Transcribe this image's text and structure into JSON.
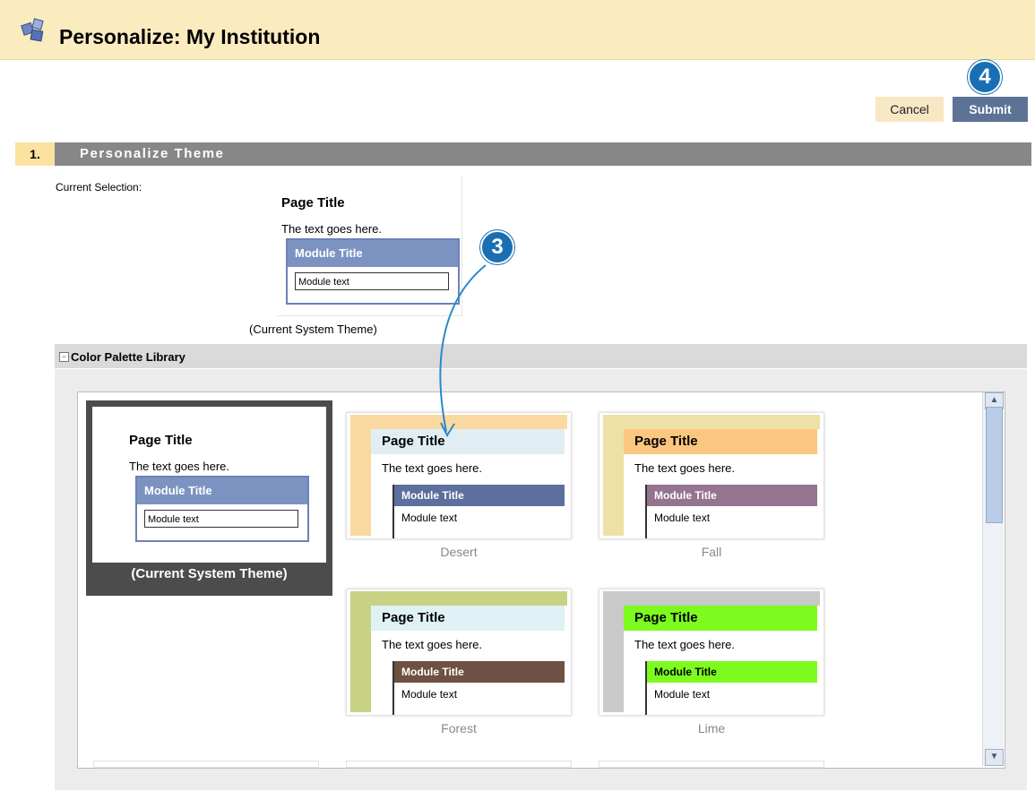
{
  "page": {
    "title": "Personalize: My Institution"
  },
  "buttons": {
    "cancel": "Cancel",
    "submit": "Submit"
  },
  "callouts": {
    "submit_step": "4",
    "select_step": "3"
  },
  "section": {
    "number": "1.",
    "title": "Personalize Theme"
  },
  "current": {
    "label": "Current Selection:",
    "page_title": "Page Title",
    "text": "The text goes here.",
    "module_title": "Module Title",
    "module_text": "Module text",
    "name": "(Current System Theme)"
  },
  "library": {
    "toggle": "−",
    "title": "Color Palette Library",
    "themes": [
      {
        "name": "(Current System Theme)",
        "page_title": "Page Title",
        "text": "The text goes here.",
        "module_title": "Module Title",
        "module_text": "Module text",
        "colors": {
          "frame": "#4c4c4c",
          "module_header": "#7c93c2"
        }
      },
      {
        "name": "Desert",
        "page_title": "Page Title",
        "text": "The text goes here.",
        "module_title": "Module Title",
        "module_text": "Module text",
        "colors": {
          "band": "#fad9a0",
          "title_bg": "#e0eef3",
          "module_header": "#5c6f9d"
        }
      },
      {
        "name": "Fall",
        "page_title": "Page Title",
        "text": "The text goes here.",
        "module_title": "Module Title",
        "module_text": "Module text",
        "colors": {
          "band": "#ede1a6",
          "title_bg": "#fbc680",
          "module_header": "#94748f"
        }
      },
      {
        "name": "Forest",
        "page_title": "Page Title",
        "text": "The text goes here.",
        "module_title": "Module Title",
        "module_text": "Module text",
        "colors": {
          "band": "#c8d283",
          "title_bg": "#e0f1f5",
          "module_header": "#6e5143"
        }
      },
      {
        "name": "Lime",
        "page_title": "Page Title",
        "text": "The text goes here.",
        "module_title": "Module Title",
        "module_text": "Module text",
        "colors": {
          "band": "#c9c9c9",
          "title_bg": "#7dfb1f",
          "module_header": "#7dfb1f"
        }
      }
    ]
  },
  "icons": {
    "logo": "blocks-logo-icon",
    "scroll_up": "chevron-up-icon",
    "scroll_down": "chevron-down-icon"
  }
}
